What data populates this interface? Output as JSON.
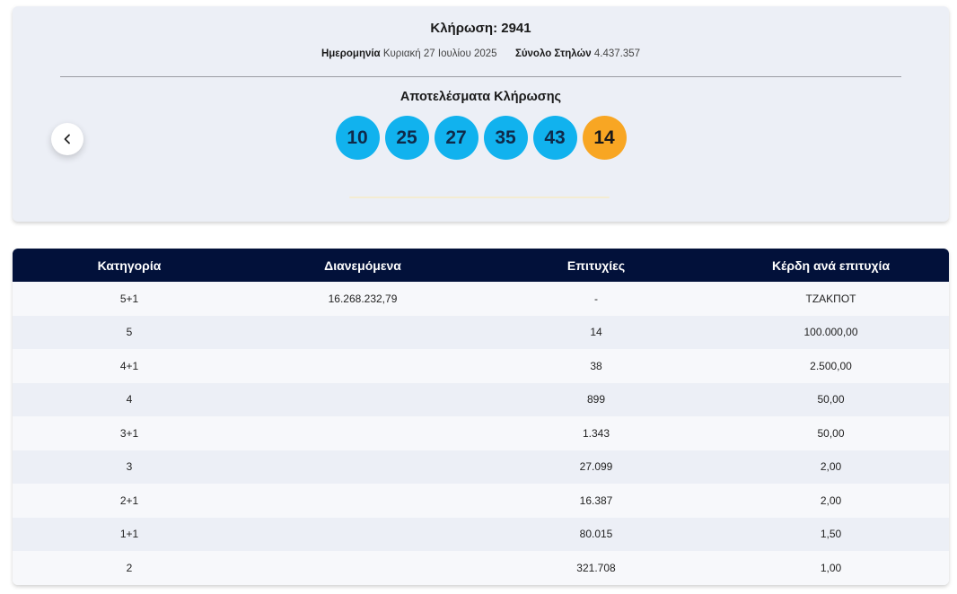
{
  "draw": {
    "title": "Κλήρωση: 2941",
    "date_label": "Ημερομηνία",
    "date_value": "Κυριακή 27 Ιουλίου 2025",
    "columns_label": "Σύνολο Στηλών",
    "columns_value": "4.437.357",
    "results_title": "Αποτελέσματα Κλήρωσης",
    "numbers": [
      "10",
      "25",
      "27",
      "35",
      "43"
    ],
    "bonus": "14",
    "prev_icon": "chevron-left-icon",
    "colors": {
      "main_ball": "#11b2ee",
      "bonus_ball": "#f8a623",
      "header": "#02113a"
    }
  },
  "table": {
    "headers": [
      "Κατηγορία",
      "Διανεμόμενα",
      "Επιτυχίες",
      "Κέρδη ανά επιτυχία"
    ],
    "rows": [
      [
        "5+1",
        "16.268.232,79",
        "-",
        "ΤΖΑΚΠΟΤ"
      ],
      [
        "5",
        "",
        "14",
        "100.000,00"
      ],
      [
        "4+1",
        "",
        "38",
        "2.500,00"
      ],
      [
        "4",
        "",
        "899",
        "50,00"
      ],
      [
        "3+1",
        "",
        "1.343",
        "50,00"
      ],
      [
        "3",
        "",
        "27.099",
        "2,00"
      ],
      [
        "2+1",
        "",
        "16.387",
        "2,00"
      ],
      [
        "1+1",
        "",
        "80.015",
        "1,50"
      ],
      [
        "2",
        "",
        "321.708",
        "1,00"
      ]
    ]
  }
}
